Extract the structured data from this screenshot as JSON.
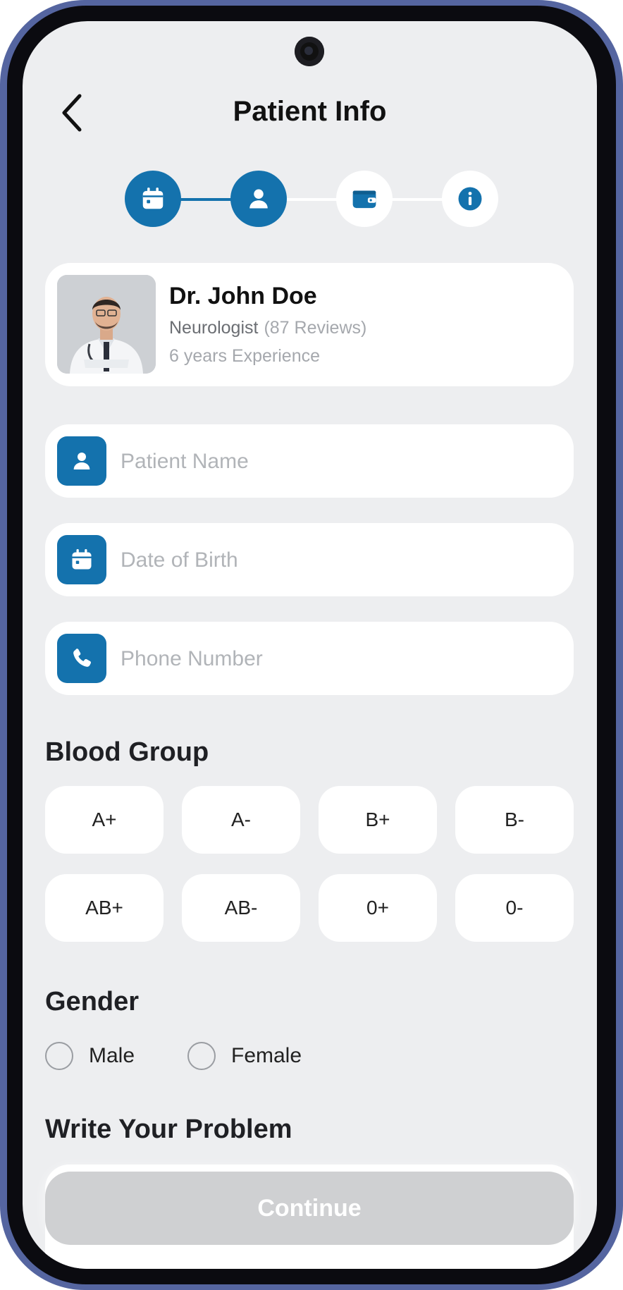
{
  "header": {
    "title": "Patient Info",
    "back_icon": "chevron-left-icon"
  },
  "stepper": {
    "steps": [
      {
        "icon": "calendar-icon",
        "state": "active"
      },
      {
        "icon": "user-icon",
        "state": "active"
      },
      {
        "icon": "wallet-icon",
        "state": "inactive"
      },
      {
        "icon": "info-icon",
        "state": "inactive"
      }
    ]
  },
  "doctor": {
    "name": "Dr. John Doe",
    "specialty": "Neurologist",
    "reviews": "(87 Reviews)",
    "experience": "6 years Experience"
  },
  "form": {
    "patient_name": {
      "placeholder": "Patient Name",
      "value": "",
      "icon": "user-icon"
    },
    "date_of_birth": {
      "placeholder": "Date of Birth",
      "value": "",
      "icon": "calendar-icon"
    },
    "phone_number": {
      "placeholder": "Phone Number",
      "value": "",
      "icon": "phone-icon"
    }
  },
  "blood_group": {
    "title": "Blood Group",
    "options": [
      "A+",
      "A-",
      "B+",
      "B-",
      "AB+",
      "AB-",
      "0+",
      "0-"
    ]
  },
  "gender": {
    "title": "Gender",
    "options": [
      "Male",
      "Female"
    ]
  },
  "problem": {
    "title": "Write Your Problem"
  },
  "continue_label": "Continue",
  "colors": {
    "accent": "#1472ad",
    "background": "#edeef0",
    "card": "#ffffff",
    "button_disabled": "#cfd0d2",
    "placeholder": "#b1b4b8"
  }
}
